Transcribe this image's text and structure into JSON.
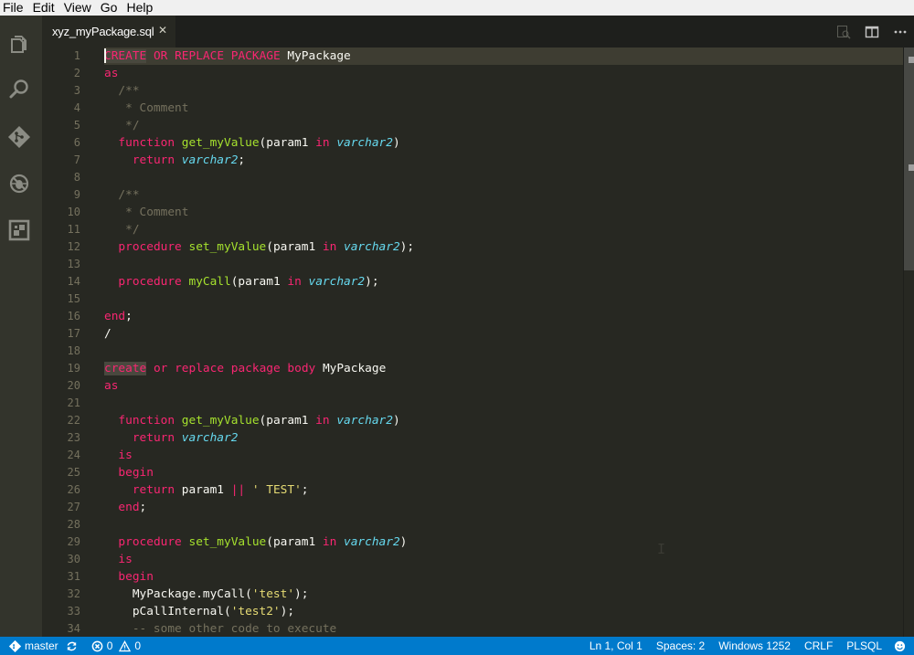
{
  "menu": [
    "File",
    "Edit",
    "View",
    "Go",
    "Help"
  ],
  "activity_bar": [
    "explorer-icon",
    "search-icon",
    "git-icon",
    "debug-icon",
    "extensions-icon"
  ],
  "tab": {
    "label": "xyz_myPackage.sql",
    "close": "✕"
  },
  "tab_actions": [
    "open-preview-icon",
    "split-editor-icon",
    "more-actions-icon"
  ],
  "editor": {
    "current_line": 1,
    "lines": [
      [
        [
          "CREATE",
          "kw hl"
        ],
        [
          " ",
          ""
        ],
        [
          "OR",
          "kw"
        ],
        [
          " ",
          ""
        ],
        [
          "REPLACE",
          "kw"
        ],
        [
          " ",
          ""
        ],
        [
          "PACKAGE",
          "kw"
        ],
        [
          " MyPackage",
          ""
        ]
      ],
      [
        [
          "as",
          "kw"
        ]
      ],
      [
        [
          "  /**",
          "cm"
        ]
      ],
      [
        [
          "   * Comment",
          "cm"
        ]
      ],
      [
        [
          "   */",
          "cm"
        ]
      ],
      [
        [
          "  ",
          ""
        ],
        [
          "function",
          "kw"
        ],
        [
          " ",
          ""
        ],
        [
          "get_myValue",
          "fn"
        ],
        [
          "(param1 ",
          ""
        ],
        [
          "in",
          "kw"
        ],
        [
          " ",
          ""
        ],
        [
          "varchar2",
          "ty"
        ],
        [
          ")",
          ""
        ]
      ],
      [
        [
          "    ",
          ""
        ],
        [
          "return",
          "kw"
        ],
        [
          " ",
          ""
        ],
        [
          "varchar2",
          "ty"
        ],
        [
          ";",
          ""
        ]
      ],
      [],
      [
        [
          "  /**",
          "cm"
        ]
      ],
      [
        [
          "   * Comment",
          "cm"
        ]
      ],
      [
        [
          "   */",
          "cm"
        ]
      ],
      [
        [
          "  ",
          ""
        ],
        [
          "procedure",
          "kw"
        ],
        [
          " ",
          ""
        ],
        [
          "set_myValue",
          "fn"
        ],
        [
          "(param1 ",
          ""
        ],
        [
          "in",
          "kw"
        ],
        [
          " ",
          ""
        ],
        [
          "varchar2",
          "ty"
        ],
        [
          ");",
          ""
        ]
      ],
      [],
      [
        [
          "  ",
          ""
        ],
        [
          "procedure",
          "kw"
        ],
        [
          " ",
          ""
        ],
        [
          "myCall",
          "fn"
        ],
        [
          "(param1 ",
          ""
        ],
        [
          "in",
          "kw"
        ],
        [
          " ",
          ""
        ],
        [
          "varchar2",
          "ty"
        ],
        [
          ");",
          ""
        ]
      ],
      [],
      [
        [
          "end",
          "kw"
        ],
        [
          ";",
          ""
        ]
      ],
      [
        [
          "/",
          ""
        ]
      ],
      [],
      [
        [
          "create",
          "kw hl"
        ],
        [
          " ",
          ""
        ],
        [
          "or",
          "kw"
        ],
        [
          " ",
          ""
        ],
        [
          "replace",
          "kw"
        ],
        [
          " ",
          ""
        ],
        [
          "package",
          "kw"
        ],
        [
          " ",
          ""
        ],
        [
          "body",
          "kw"
        ],
        [
          " MyPackage",
          ""
        ]
      ],
      [
        [
          "as",
          "kw"
        ]
      ],
      [],
      [
        [
          "  ",
          ""
        ],
        [
          "function",
          "kw"
        ],
        [
          " ",
          ""
        ],
        [
          "get_myValue",
          "fn"
        ],
        [
          "(param1 ",
          ""
        ],
        [
          "in",
          "kw"
        ],
        [
          " ",
          ""
        ],
        [
          "varchar2",
          "ty"
        ],
        [
          ")",
          ""
        ]
      ],
      [
        [
          "    ",
          ""
        ],
        [
          "return",
          "kw"
        ],
        [
          " ",
          ""
        ],
        [
          "varchar2",
          "ty"
        ]
      ],
      [
        [
          "  ",
          ""
        ],
        [
          "is",
          "kw"
        ]
      ],
      [
        [
          "  ",
          ""
        ],
        [
          "begin",
          "kw"
        ]
      ],
      [
        [
          "    ",
          ""
        ],
        [
          "return",
          "kw"
        ],
        [
          " param1 ",
          ""
        ],
        [
          "||",
          "kw"
        ],
        [
          " ",
          ""
        ],
        [
          "' TEST'",
          "str"
        ],
        [
          ";",
          ""
        ]
      ],
      [
        [
          "  ",
          ""
        ],
        [
          "end",
          "kw"
        ],
        [
          ";",
          ""
        ]
      ],
      [],
      [
        [
          "  ",
          ""
        ],
        [
          "procedure",
          "kw"
        ],
        [
          " ",
          ""
        ],
        [
          "set_myValue",
          "fn"
        ],
        [
          "(param1 ",
          ""
        ],
        [
          "in",
          "kw"
        ],
        [
          " ",
          ""
        ],
        [
          "varchar2",
          "ty"
        ],
        [
          ")",
          ""
        ]
      ],
      [
        [
          "  ",
          ""
        ],
        [
          "is",
          "kw"
        ]
      ],
      [
        [
          "  ",
          ""
        ],
        [
          "begin",
          "kw"
        ]
      ],
      [
        [
          "    MyPackage.myCall(",
          ""
        ],
        [
          "'test'",
          "str"
        ],
        [
          ");",
          ""
        ]
      ],
      [
        [
          "    pCallInternal(",
          ""
        ],
        [
          "'test2'",
          "str"
        ],
        [
          ");",
          ""
        ]
      ],
      [
        [
          "    -- some other code to execute",
          "cm"
        ]
      ]
    ]
  },
  "status": {
    "branch": "master",
    "errors": "0",
    "warnings": "0",
    "position": "Ln 1, Col 1",
    "indent": "Spaces: 2",
    "encoding": "Windows 1252",
    "eol": "CRLF",
    "language": "PLSQL"
  },
  "colors": {
    "keyword": "#f92672",
    "function": "#a6e22e",
    "type": "#66d9ef",
    "string": "#e6db74",
    "comment": "#75715e",
    "statusbar": "#007acc"
  }
}
